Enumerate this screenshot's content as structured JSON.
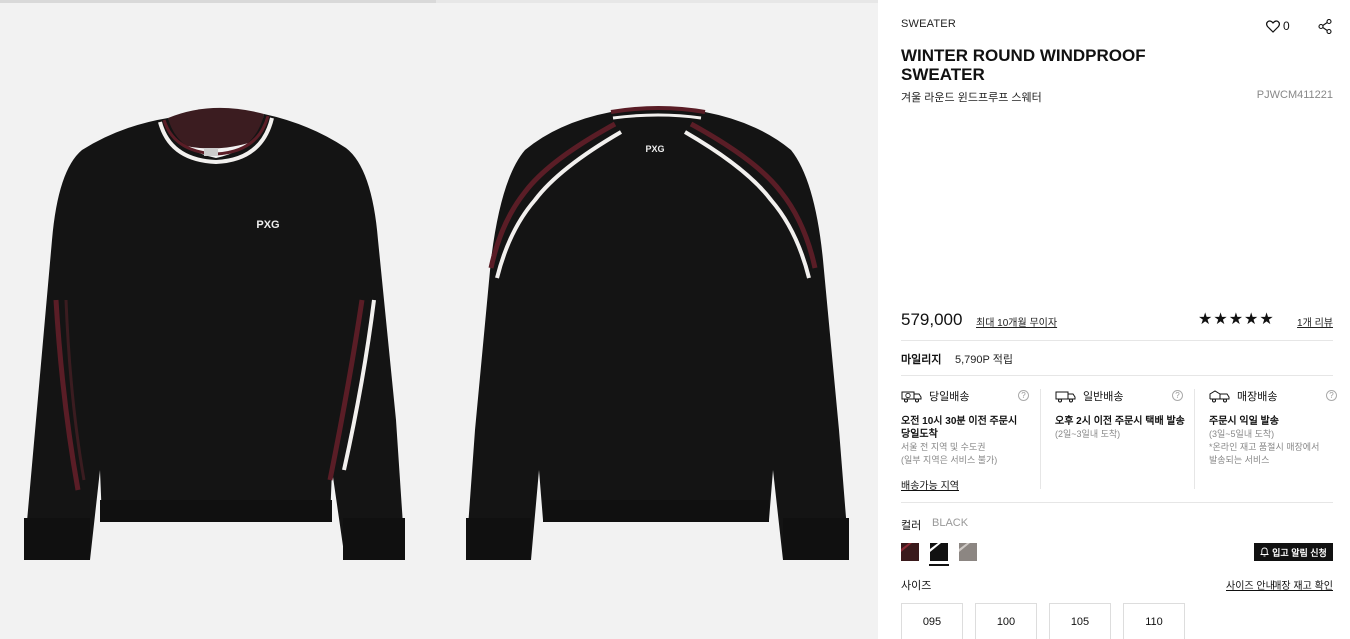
{
  "product": {
    "category": "SWEATER",
    "wish_count": "0",
    "title": "WINTER ROUND WINDPROOF SWEATER",
    "subtitle": "겨울 라운드 윈드프루프 스웨터",
    "code": "PJWCM411221",
    "price": "579,000",
    "installment_label": "최대 10개월 무이자",
    "rating_stars": 5,
    "stars_display": "★★★★★",
    "review_link": "1개 리뷰"
  },
  "images": {
    "front_logo": "PXG",
    "back_logo": "PXG"
  },
  "mileage": {
    "label": "마일리지",
    "value": "5,790P 적립"
  },
  "shipping": [
    {
      "icon": "truck-clock-icon",
      "title": "당일배송",
      "bold": [
        "오전 10시 30분 이전 주문시",
        "당일도착"
      ],
      "notes": [
        "서울 전 지역 및 수도권",
        "(일부 지역은 서비스 불가)"
      ]
    },
    {
      "icon": "truck-icon",
      "title": "일반배송",
      "bold": [
        "오후 2시 이전 주문시 택배 발송"
      ],
      "notes": [
        "(2일~3일내 도착)"
      ]
    },
    {
      "icon": "store-truck-icon",
      "title": "매장배송",
      "bold": [
        "주문시 익일 발송"
      ],
      "notes": [
        "(3일~5일내 도착)",
        "*온라인 재고 품절시 매장에서",
        "발송되는 서비스"
      ]
    }
  ],
  "shipping_area_link": "배송가능 지역",
  "help_glyph": "?",
  "color": {
    "label": "컬러",
    "selected": "BLACK",
    "swatches": [
      {
        "name": "burgundy",
        "color": "#3a1a1c",
        "stripe": "#8a2a35"
      },
      {
        "name": "black",
        "color": "#111111",
        "stripe": "#ffffff"
      },
      {
        "name": "grey",
        "color": "#8c8682",
        "stripe": "#cfcac6"
      }
    ]
  },
  "restock_button": "입고 알림 신청",
  "size": {
    "label": "사이즈",
    "guide_link": "사이즈 안내",
    "store_stock_link": "매장 재고 확인",
    "options": [
      "095",
      "100",
      "105",
      "110"
    ]
  },
  "colors": {
    "sweater": "#141414",
    "stripe_maroon": "#5a1d26",
    "stripe_white": "#f2f0ee",
    "gallery_bg": "#f2f2f2"
  }
}
